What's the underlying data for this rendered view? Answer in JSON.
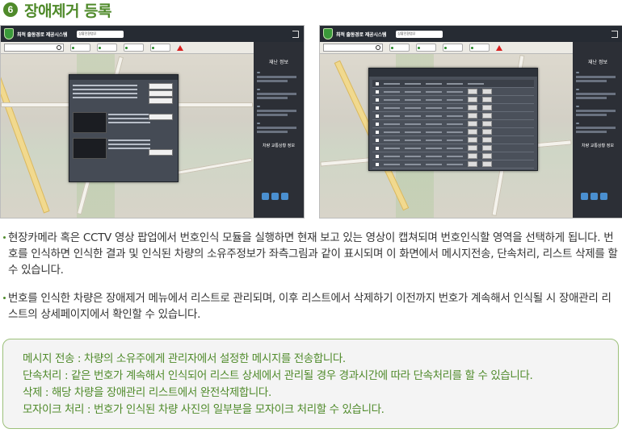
{
  "section": {
    "number": "6",
    "title": "장애제거 등록"
  },
  "screenshots": {
    "app_title": "최적 출동경로 제공시스템",
    "search_box": "상황전환탭푸",
    "side_panel_title": "재난 정보",
    "side_panel_sub": "차량 교통상황 정보"
  },
  "bullets": [
    "현장카메라 혹은 CCTV 영상 팝업에서 번호인식 모듈을 실행하면 현재 보고 있는 영상이 캡쳐되며 번호인식할 영역을 선택하게 됩니다. 번호를 인식하면 인식한 결과 및 인식된 차량의 소유주정보가 좌측그림과 같이 표시되며 이 화면에서 메시지전송, 단속처리, 리스트 삭제를 할 수 있습니다.",
    "번호를 인식한 차량은 장애제거 메뉴에서 리스트로 관리되며, 이후 리스트에서 삭제하기 이전까지 번호가 계속해서 인식될 시 장애관리 리스트의 상세페이지에서 확인할 수 있습니다."
  ],
  "notes": [
    "메시지 전송 : 차량의 소유주에게 관리자에서 설정한 메시지를 전송합니다.",
    "단속처리 : 같은 번호가 계속해서 인식되어 리스트 상세에서 관리될 경우 경과시간에 따라 단속처리를 할 수 있습니다.",
    "삭제 : 해당 차량을 장애관리 리스트에서 완전삭제합니다.",
    "모자이크 처리 : 번호가 인식된 차량 사진의 일부분을 모자이크 처리할 수 있습니다."
  ],
  "colors": {
    "accent_green": "#4f8a2a",
    "box_border": "#9cc07a",
    "app_dark": "#262b33"
  }
}
